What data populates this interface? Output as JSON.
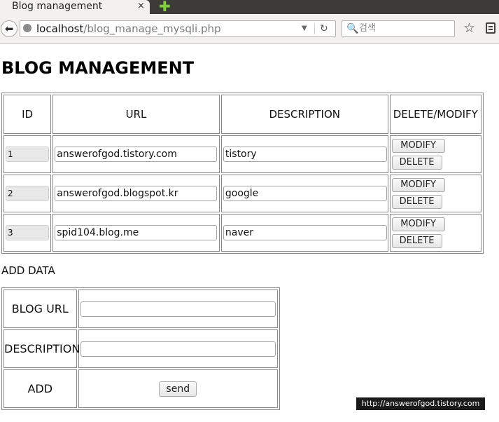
{
  "browser": {
    "tab_title": "Blog management",
    "tab_close": "×",
    "new_tab": "✚",
    "back": "⬅",
    "url_host": "localhost",
    "url_path": "/blog_manage_mysqli.php",
    "dropdown": "▼",
    "reload": "↻",
    "search_icon": "🔍",
    "search_placeholder": "검색",
    "bookmark_star": "☆"
  },
  "page": {
    "title": "BLOG MANAGEMENT",
    "table": {
      "headers": [
        "ID",
        "URL",
        "DESCRIPTION",
        "DELETE/MODIFY"
      ],
      "rows": [
        {
          "id": "1",
          "url": "answerofgod.tistory.com",
          "description": "tistory"
        },
        {
          "id": "2",
          "url": "answerofgod.blogspot.kr",
          "description": "google"
        },
        {
          "id": "3",
          "url": "spid104.blog.me",
          "description": "naver"
        }
      ],
      "modify_label": "MODIFY",
      "delete_label": "DELETE"
    },
    "add": {
      "heading": "ADD DATA",
      "blog_url_label": "BLOG URL",
      "description_label": "DESCRIPTION",
      "add_label": "ADD",
      "blog_url_value": "",
      "description_value": "",
      "send_label": "send"
    }
  },
  "watermark": "http://answerofgod.tistory.com"
}
